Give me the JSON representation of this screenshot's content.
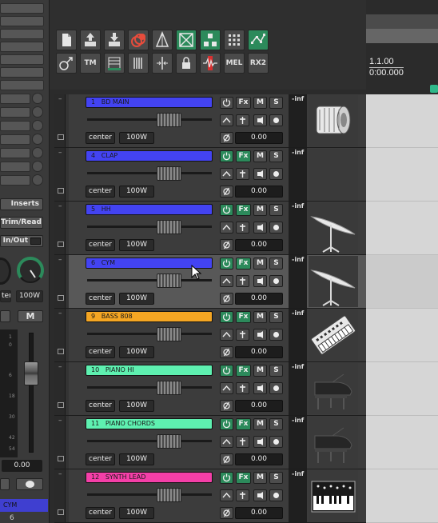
{
  "master": {
    "inserts_label": "Inserts",
    "trimread_label": "Trim/Read",
    "inout_label": "In/Out",
    "pan_label": "ter",
    "mode_label": "100W",
    "mute_label": "M",
    "scale": [
      "1",
      "0",
      "6",
      "18",
      "30",
      "42",
      "54"
    ],
    "volume": "0.00",
    "selected_track": "CYM",
    "selected_number": "6"
  },
  "toolbar": {
    "row2_labels": [
      "TM",
      "MEL",
      "RX2"
    ]
  },
  "timeline": {
    "bar_position": "1.1.00",
    "time_position": "0:00.000"
  },
  "track_controls": {
    "fx_label": "Fx",
    "mute_label": "M",
    "solo_label": "S",
    "peak_label": "-inf"
  },
  "tracks": [
    {
      "number": "1",
      "name": "BD MAIN",
      "color": "#4343f2",
      "pan": "center",
      "mode": "100W",
      "volume": "0.00",
      "icon": "bass-drum-icon",
      "selected": false
    },
    {
      "number": "4",
      "name": "CLAP",
      "color": "#4343f2",
      "pan": "center",
      "mode": "100W",
      "volume": "0.00",
      "icon": "empty-icon",
      "selected": false
    },
    {
      "number": "5",
      "name": "HH",
      "color": "#4343f2",
      "pan": "center",
      "mode": "100W",
      "volume": "0.00",
      "icon": "cymbal-icon",
      "selected": false
    },
    {
      "number": "6",
      "name": "CYM",
      "color": "#4343f2",
      "pan": "center",
      "mode": "100W",
      "volume": "0.00",
      "icon": "cymbal-icon",
      "selected": true
    },
    {
      "number": "9",
      "name": "BASS 808",
      "color": "#f5a623",
      "pan": "center",
      "mode": "100W",
      "volume": "0.00",
      "icon": "synthesizer-icon",
      "selected": false
    },
    {
      "number": "10",
      "name": "PIANO HI",
      "color": "#5ef0b0",
      "pan": "center",
      "mode": "100W",
      "volume": "0.00",
      "icon": "grand-piano-icon",
      "selected": false
    },
    {
      "number": "11",
      "name": "PIANO CHORDS",
      "color": "#5ef0b0",
      "pan": "center",
      "mode": "100W",
      "volume": "0.00",
      "icon": "grand-piano-icon",
      "selected": false
    },
    {
      "number": "12",
      "name": "SYNTH LEAD",
      "color": "#f53fa8",
      "pan": "center",
      "mode": "100W",
      "volume": "0.00",
      "icon": "keyboard-icon",
      "selected": false
    }
  ]
}
